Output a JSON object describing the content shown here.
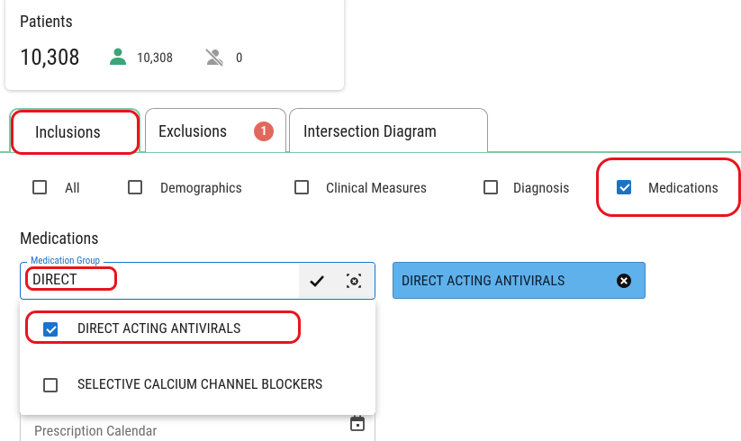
{
  "patients_card": {
    "title": "Patients",
    "total": "10,308",
    "active_count": "10,308",
    "inactive_count": "0",
    "active_icon": "person-icon",
    "inactive_icon": "person-off-icon"
  },
  "tabs": [
    {
      "label": "Inclusions",
      "active": true
    },
    {
      "label": "Exclusions",
      "badge": "1"
    },
    {
      "label": "Intersection Diagram"
    }
  ],
  "filters": [
    {
      "label": "All",
      "checked": false
    },
    {
      "label": "Demographics",
      "checked": false
    },
    {
      "label": "Clinical Measures",
      "checked": false
    },
    {
      "label": "Diagnosis",
      "checked": false
    },
    {
      "label": "Medications",
      "checked": true
    }
  ],
  "medications": {
    "section_title": "Medications",
    "field_label": "Medication Group",
    "field_value": "DIRECT",
    "selected_chip": "DIRECT ACTING ANTIVIRALS",
    "options": [
      {
        "label": "DIRECT ACTING ANTIVIRALS",
        "checked": true
      },
      {
        "label": "SELECTIVE CALCIUM CHANNEL BLOCKERS",
        "checked": false
      }
    ],
    "calendar_placeholder": "Prescription Calendar"
  },
  "colors": {
    "accent_blue": "#1a73c9",
    "chip_blue": "#5fb1ec",
    "tab_green": "#7cc9a8",
    "badge_red": "#e2685c",
    "annotation_red": "#e8141e",
    "person_green": "#3aa57a"
  }
}
